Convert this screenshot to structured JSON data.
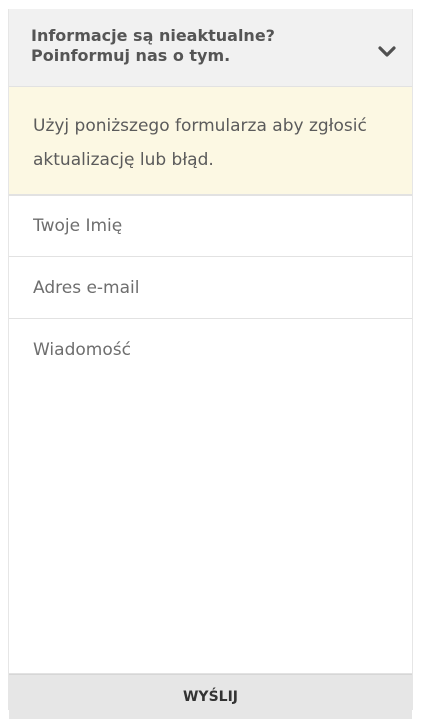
{
  "header": {
    "title": "Informacje są nieaktualne? Poinformuj nas o tym.",
    "toggle_icon": "chevron-down-icon"
  },
  "notice": {
    "text": "Użyj poniższego formularza aby zgłosić aktualizację lub błąd."
  },
  "form": {
    "name_placeholder": "Twoje Imię",
    "email_placeholder": "Adres e-mail",
    "message_placeholder": "Wiadomość",
    "submit_label": "WYŚLIJ"
  },
  "colors": {
    "header_bg": "#f1f1f1",
    "notice_bg": "#fcf8e3",
    "button_bg": "#e6e6e6",
    "text": "#555555"
  }
}
